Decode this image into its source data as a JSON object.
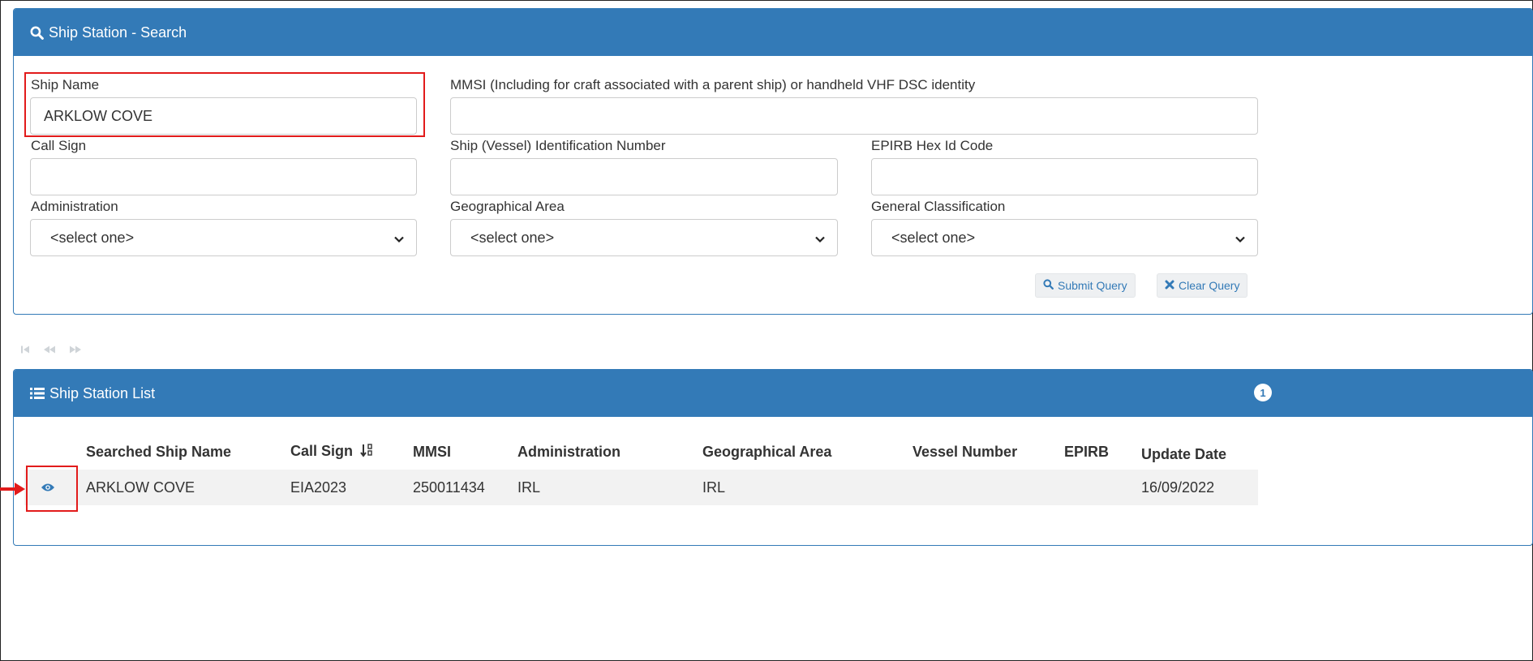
{
  "search_panel": {
    "title": "Ship Station - Search",
    "fields": {
      "ship_name": {
        "label": "Ship Name",
        "value": "ARKLOW COVE"
      },
      "mmsi": {
        "label": "MMSI (Including for craft associated with a parent ship) or handheld VHF DSC identity",
        "value": ""
      },
      "call_sign": {
        "label": "Call Sign",
        "value": ""
      },
      "ship_id_number": {
        "label": "Ship (Vessel) Identification Number",
        "value": ""
      },
      "epirb_hex": {
        "label": "EPIRB Hex Id Code",
        "value": ""
      },
      "administration": {
        "label": "Administration",
        "selected": "<select one>"
      },
      "geographical_area": {
        "label": "Geographical Area",
        "selected": "<select one>"
      },
      "general_classification": {
        "label": "General Classification",
        "selected": "<select one>"
      }
    },
    "buttons": {
      "submit": "Submit Query",
      "clear": "Clear Query"
    }
  },
  "list_panel": {
    "title": "Ship Station List",
    "count": "1",
    "columns": [
      "Searched Ship Name",
      "Call Sign",
      "MMSI",
      "Administration",
      "Geographical Area",
      "Vessel Number",
      "EPIRB",
      "Update Date"
    ],
    "rows": [
      {
        "ship_name": "ARKLOW COVE",
        "call_sign": "EIA2023",
        "mmsi": "250011434",
        "administration": "IRL",
        "geographical_area": "IRL",
        "vessel_number": "",
        "epirb": "",
        "update_date": "16/09/2022"
      }
    ]
  },
  "colors": {
    "primary": "#337ab7",
    "highlight": "#e21b1b"
  }
}
